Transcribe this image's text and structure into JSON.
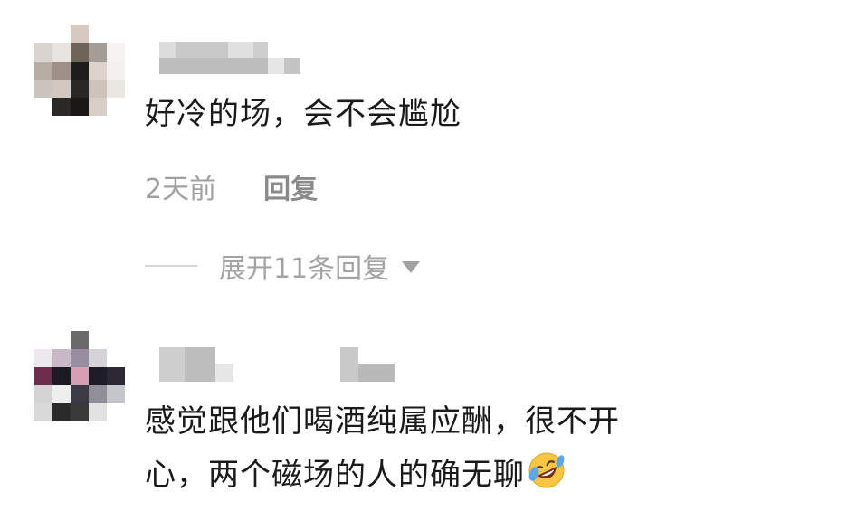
{
  "comments": [
    {
      "text": "好冷的场，会不会尴尬",
      "time": "2天前",
      "reply_label": "回复",
      "expand_label": "展开11条回复"
    },
    {
      "text_line1": "感觉跟他们喝酒纯属应酬，很不开",
      "text_line2": "心，两个磁场的人的确无聊",
      "emoji": "rolling-on-floor-laughing-emoji"
    }
  ]
}
